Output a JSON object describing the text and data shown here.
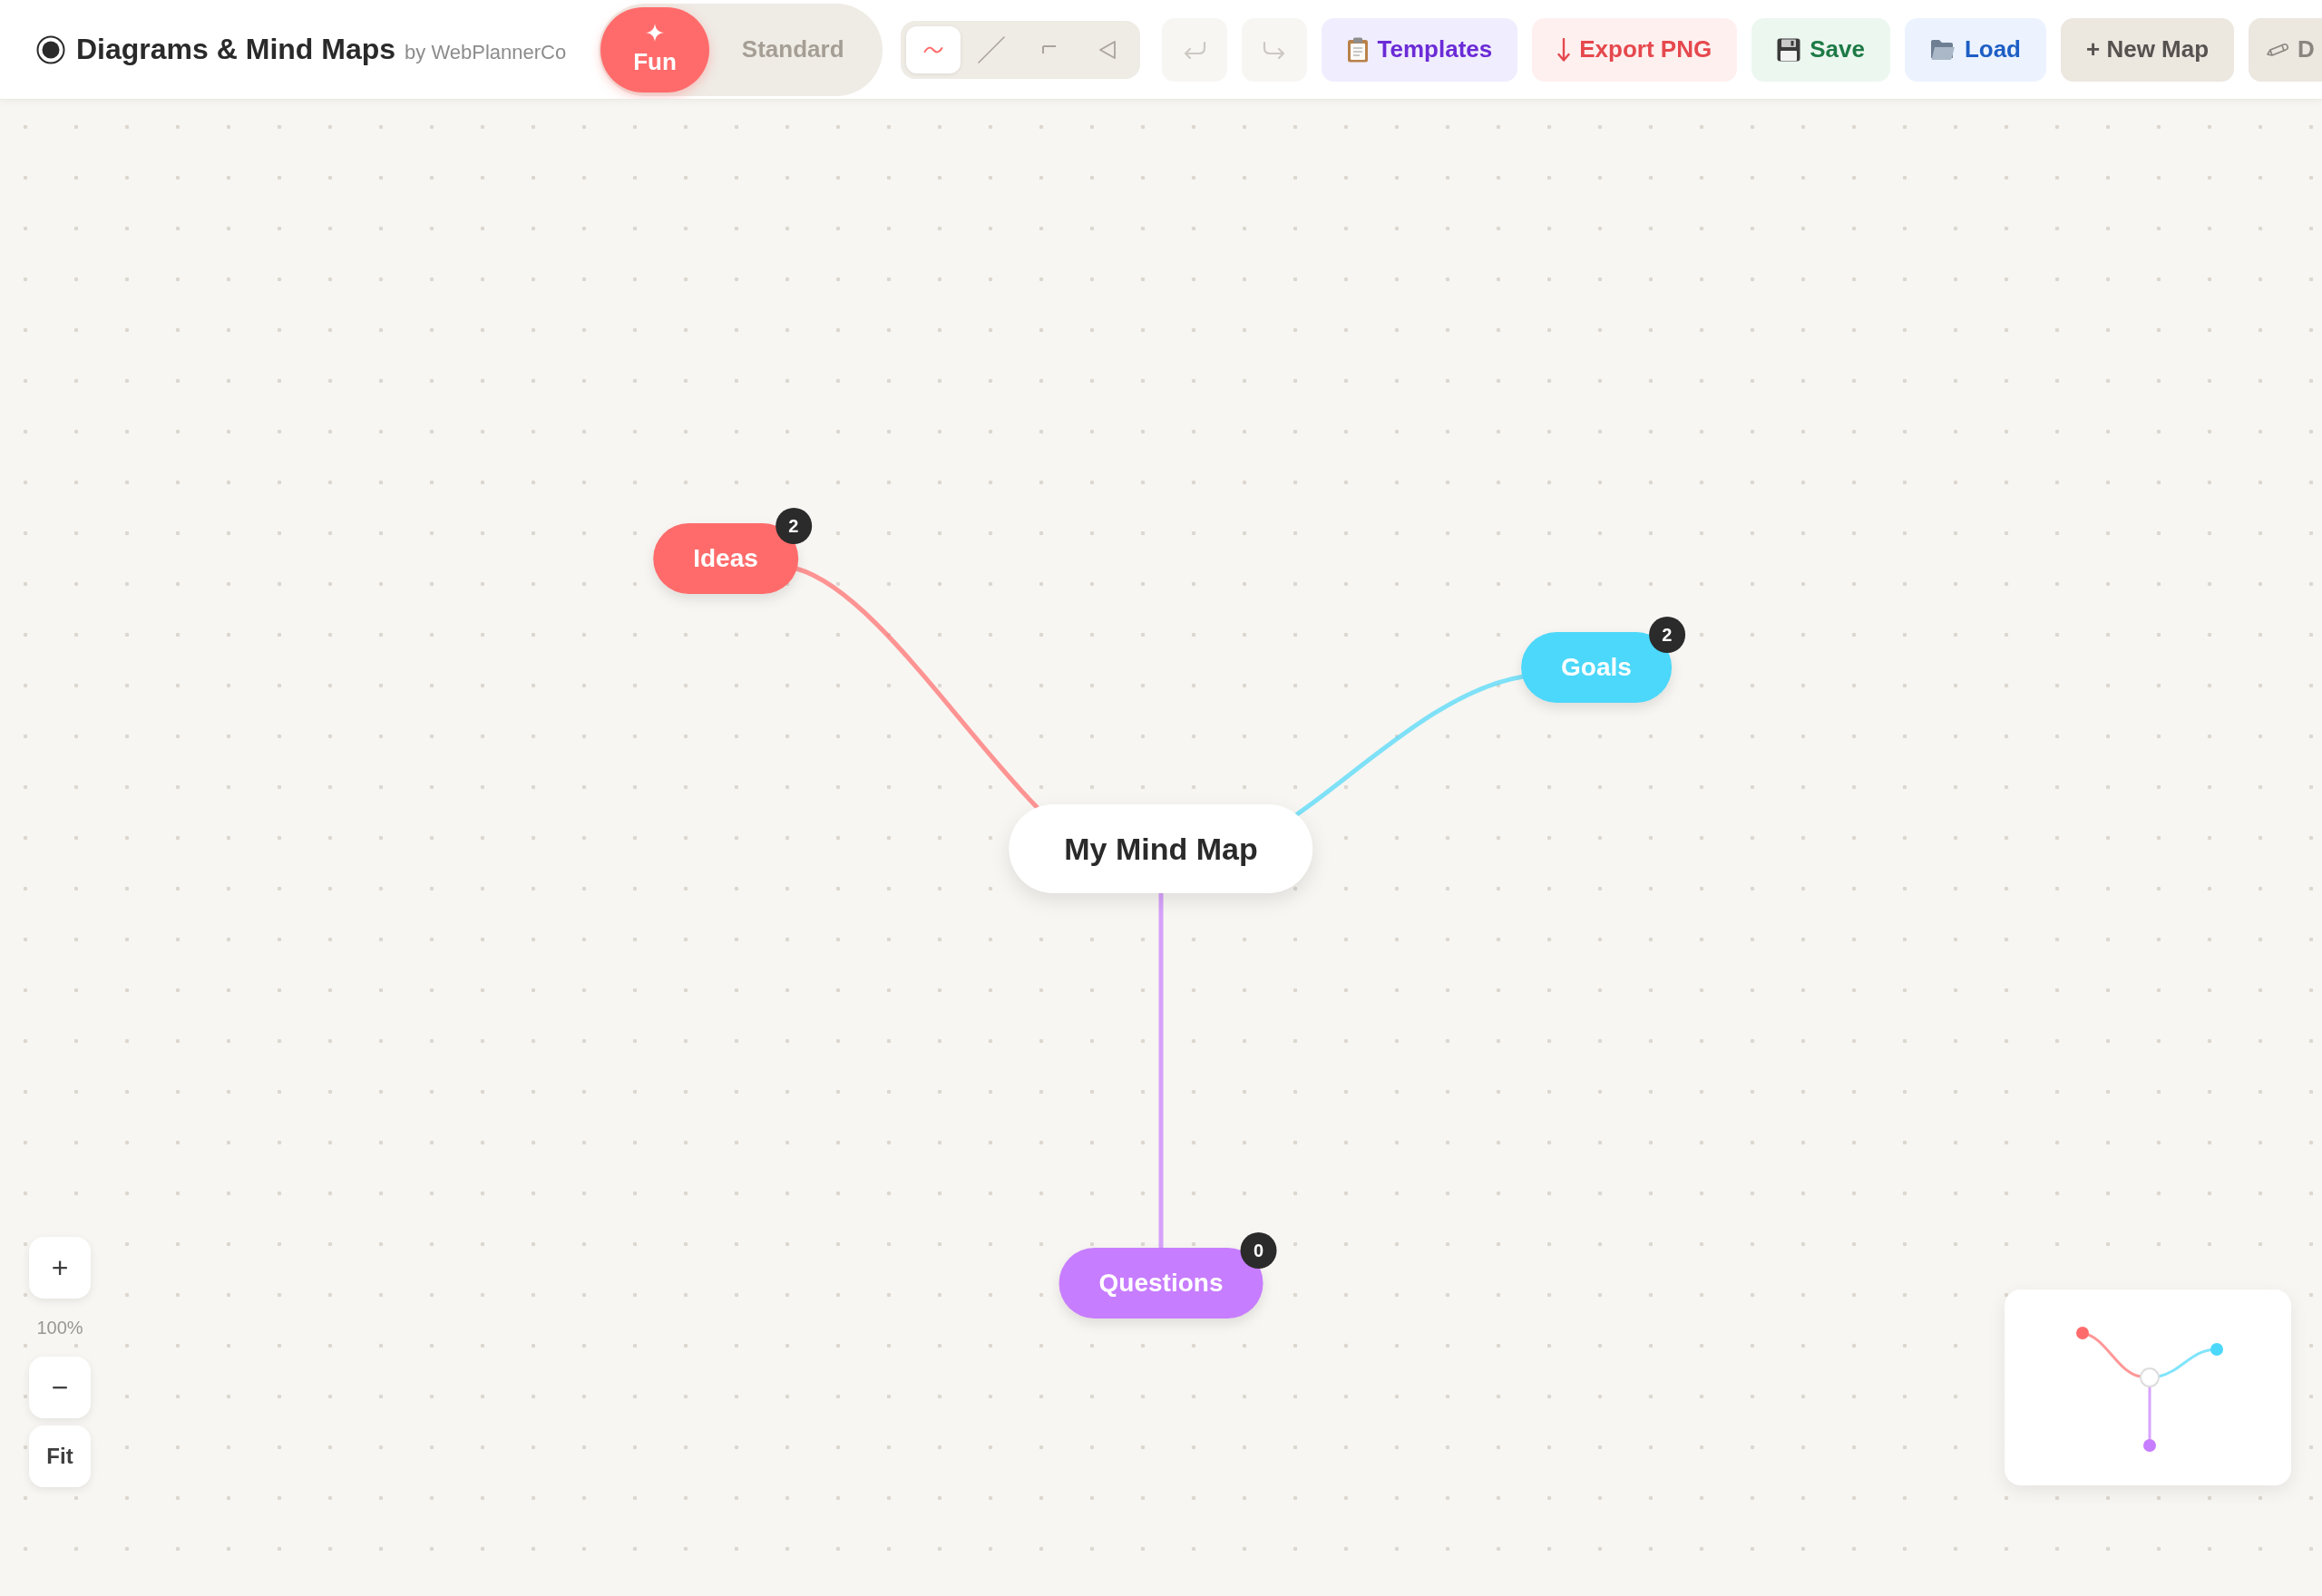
{
  "app_header": {
    "title": "Diagrams & Mind Maps",
    "byline": "by WebPlannerCo"
  },
  "mode_toggle": [
    {
      "label": "Fun",
      "selected": true
    },
    {
      "label": "Standard",
      "selected": false
    }
  ],
  "connector_styles": [
    {
      "kind": "curve",
      "selected": true
    },
    {
      "kind": "straight",
      "selected": false
    },
    {
      "kind": "elbow",
      "selected": false
    },
    {
      "kind": "triangle",
      "selected": false
    }
  ],
  "history_buttons": [
    {
      "kind": "undo",
      "disabled": true
    },
    {
      "kind": "redo",
      "disabled": true
    }
  ],
  "actions": [
    {
      "kind": "templates",
      "label": "Templates"
    },
    {
      "kind": "export",
      "label": "Export PNG"
    },
    {
      "kind": "save",
      "label": "Save"
    },
    {
      "kind": "load",
      "label": "Load"
    },
    {
      "kind": "new",
      "label": "+ New Map"
    },
    {
      "kind": "edit",
      "label": "D"
    }
  ],
  "mind_map": {
    "root": "My Mind Map",
    "branches": [
      {
        "label": "Ideas",
        "count": "2",
        "color": "#ff6b6b"
      },
      {
        "label": "Goals",
        "count": "2",
        "color": "#4cd8fa"
      },
      {
        "label": "Questions",
        "count": "0",
        "color": "#c77dff"
      }
    ]
  },
  "zoom_controls": {
    "zoom_in": "+",
    "level": "100%",
    "zoom_out": "−",
    "fit": "Fit"
  }
}
